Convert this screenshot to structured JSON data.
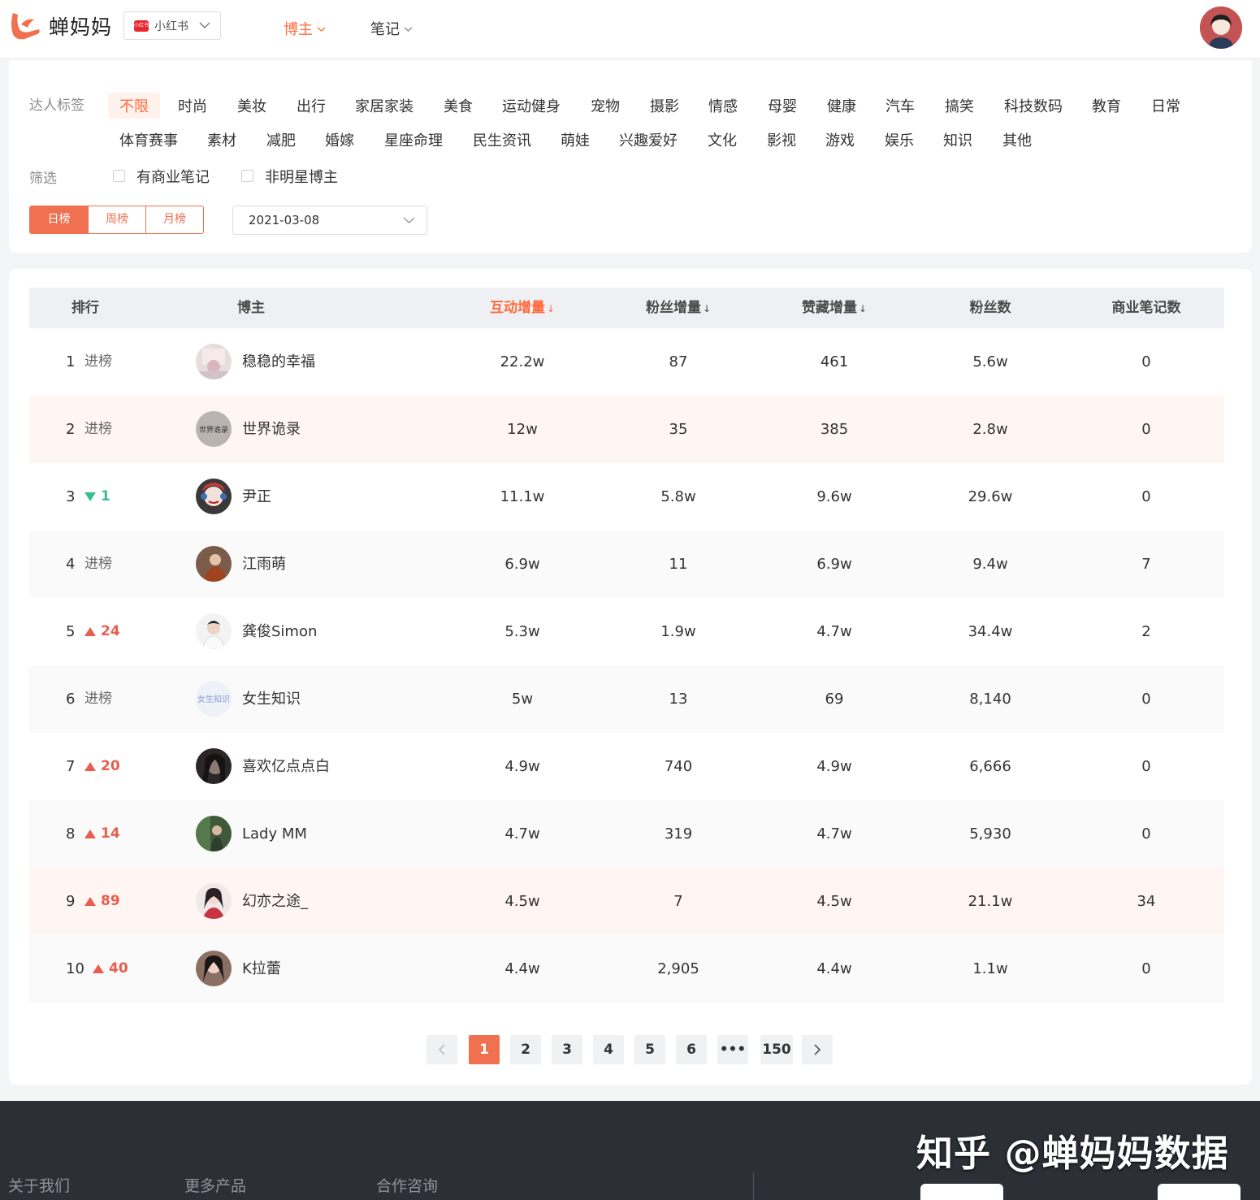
{
  "header": {
    "brand": "蝉妈妈",
    "platform": "小红书",
    "platform_badge": "小红书",
    "nav": [
      {
        "label": "博主",
        "active": true
      },
      {
        "label": "笔记",
        "active": false
      }
    ]
  },
  "filters": {
    "tags_label": "达人标签",
    "tags_row1": [
      "不限",
      "时尚",
      "美妆",
      "出行",
      "家居家装",
      "美食",
      "运动健身",
      "宠物",
      "摄影",
      "情感",
      "母婴",
      "健康",
      "汽车",
      "搞笑",
      "科技数码",
      "教育",
      "日常"
    ],
    "tags_row2": [
      "体育赛事",
      "素材",
      "减肥",
      "婚嫁",
      "星座命理",
      "民生资讯",
      "萌娃",
      "兴趣爱好",
      "文化",
      "影视",
      "游戏",
      "娱乐",
      "知识",
      "其他"
    ],
    "selected_tag": "不限",
    "screen_label": "筛选",
    "checkboxes": [
      "有商业笔记",
      "非明星博主"
    ],
    "periods": [
      "日榜",
      "周榜",
      "月榜"
    ],
    "active_period": "日榜",
    "date": "2021-03-08"
  },
  "table": {
    "columns": [
      "排行",
      "博主",
      "互动增量",
      "粉丝增量",
      "赞藏增量",
      "粉丝数",
      "商业笔记数"
    ],
    "sort_arrow": "↓",
    "rows": [
      {
        "rank": "1",
        "change": "进榜",
        "dir": "new",
        "name": "稳稳的幸福",
        "interact": "22.2w",
        "fans_inc": "87",
        "likes_inc": "461",
        "fans": "5.6w",
        "biz": "0"
      },
      {
        "rank": "2",
        "change": "进榜",
        "dir": "new",
        "name": "世界诡录",
        "interact": "12w",
        "fans_inc": "35",
        "likes_inc": "385",
        "fans": "2.8w",
        "biz": "0"
      },
      {
        "rank": "3",
        "change": "1",
        "dir": "down",
        "name": "尹正",
        "interact": "11.1w",
        "fans_inc": "5.8w",
        "likes_inc": "9.6w",
        "fans": "29.6w",
        "biz": "0"
      },
      {
        "rank": "4",
        "change": "进榜",
        "dir": "new",
        "name": "江雨萌",
        "interact": "6.9w",
        "fans_inc": "11",
        "likes_inc": "6.9w",
        "fans": "9.4w",
        "biz": "7"
      },
      {
        "rank": "5",
        "change": "24",
        "dir": "up",
        "name": "龚俊Simon",
        "interact": "5.3w",
        "fans_inc": "1.9w",
        "likes_inc": "4.7w",
        "fans": "34.4w",
        "biz": "2"
      },
      {
        "rank": "6",
        "change": "进榜",
        "dir": "new",
        "name": "女生知识",
        "interact": "5w",
        "fans_inc": "13",
        "likes_inc": "69",
        "fans": "8,140",
        "biz": "0"
      },
      {
        "rank": "7",
        "change": "20",
        "dir": "up",
        "name": "喜欢亿点点白",
        "interact": "4.9w",
        "fans_inc": "740",
        "likes_inc": "4.9w",
        "fans": "6,666",
        "biz": "0"
      },
      {
        "rank": "8",
        "change": "14",
        "dir": "up",
        "name": "Lady MM",
        "interact": "4.7w",
        "fans_inc": "319",
        "likes_inc": "4.7w",
        "fans": "5,930",
        "biz": "0"
      },
      {
        "rank": "9",
        "change": "89",
        "dir": "up",
        "name": "幻亦之途_",
        "interact": "4.5w",
        "fans_inc": "7",
        "likes_inc": "4.5w",
        "fans": "21.1w",
        "biz": "34"
      },
      {
        "rank": "10",
        "change": "40",
        "dir": "up",
        "name": "K拉蕾",
        "interact": "4.4w",
        "fans_inc": "2,905",
        "likes_inc": "4.4w",
        "fans": "1.1w",
        "biz": "0"
      }
    ]
  },
  "avatar_texts": {
    "row2": "世界诡录",
    "row6": "女生知识"
  },
  "pagination": {
    "pages": [
      "1",
      "2",
      "3",
      "4",
      "5",
      "6",
      "•••",
      "150"
    ],
    "current": "1"
  },
  "footer": {
    "links": [
      "关于我们",
      "更多产品",
      "合作咨询"
    ],
    "watermark": "知乎 @蝉妈妈数据"
  },
  "colors": {
    "accent": "#ff6a3d",
    "up": "#e85d4e",
    "down": "#35c08b",
    "footer_bg": "#2c2f36"
  }
}
